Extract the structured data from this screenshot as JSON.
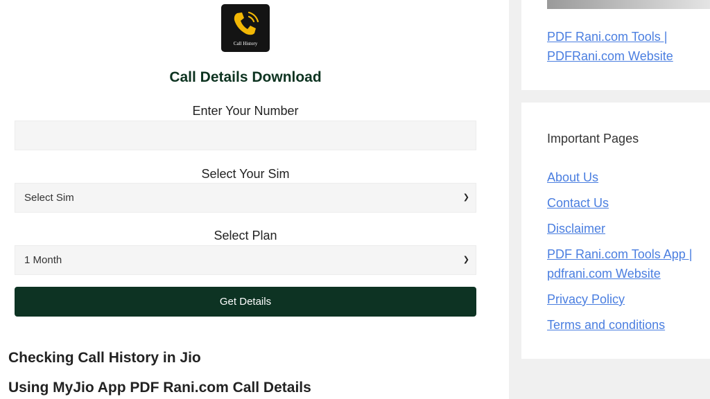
{
  "form": {
    "logo_text": "Call History",
    "title": "Call Details Download",
    "number_label": "Enter Your Number",
    "number_value": "",
    "sim_label": "Select Your Sim",
    "sim_selected": "Select Sim",
    "plan_label": "Select Plan",
    "plan_selected": "1 Month",
    "submit_label": "Get Details"
  },
  "article": {
    "heading_1": "Checking Call History in Jio",
    "heading_2": "Using MyJio App PDF Rani.com Call Details"
  },
  "sidebar": {
    "top_link": "PDF Rani.com Tools | PDFRani.com Website",
    "widget_title": "Important Pages",
    "links": [
      "About Us",
      "Contact Us",
      "Disclaimer",
      "PDF Rani.com Tools App | pdfrani.com Website",
      "Privacy Policy",
      "Terms and conditions"
    ]
  },
  "colors": {
    "brand_dark_green": "#0d3323",
    "link_blue": "#4a7ee0",
    "logo_gold": "#f2b705"
  },
  "icons": {
    "logo": "phone-handset-icon",
    "dropdown": "chevron-down-icon"
  }
}
